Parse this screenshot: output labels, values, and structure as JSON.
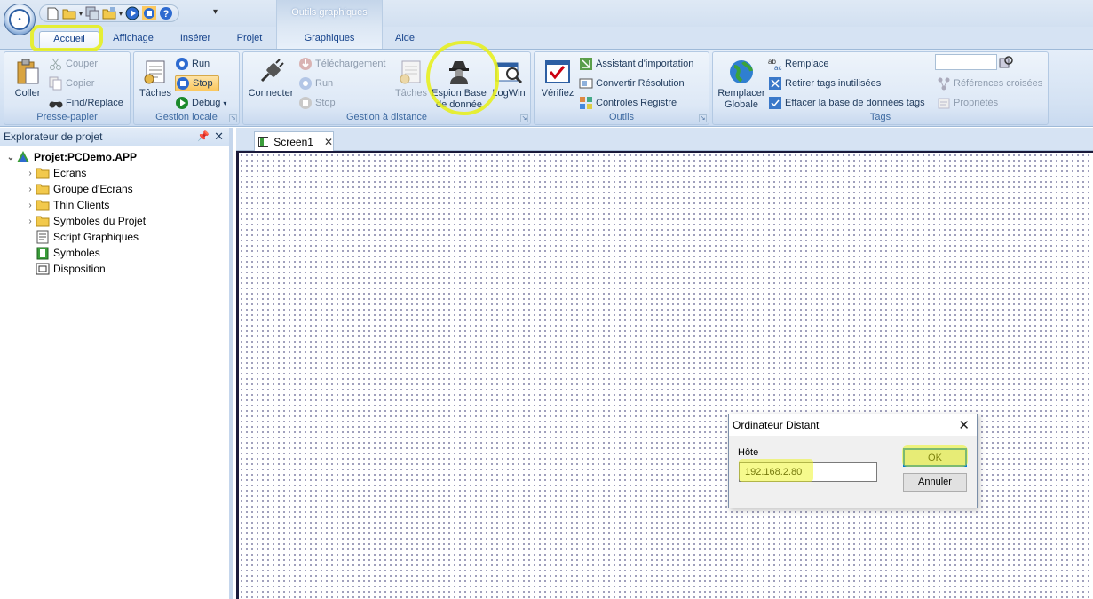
{
  "title_bar": {
    "contextual_header": "Outils graphiques"
  },
  "tabs": [
    {
      "label": "Accueil",
      "active": true
    },
    {
      "label": "Affichage"
    },
    {
      "label": "Insérer"
    },
    {
      "label": "Projet"
    },
    {
      "label": "Graphiques",
      "contextual": true
    },
    {
      "label": "Aide"
    }
  ],
  "ribbon": {
    "presse_papier": {
      "label": "Presse-papier",
      "coller": "Coller",
      "couper": "Couper",
      "copier": "Copier",
      "find_replace": "Find/Replace"
    },
    "gestion_locale": {
      "label": "Gestion locale",
      "taches": "Tâches",
      "run": "Run",
      "stop": "Stop",
      "debug": "Debug"
    },
    "gestion_distance": {
      "label": "Gestion à distance",
      "connecter": "Connecter",
      "telechargement": "Téléchargement",
      "run": "Run",
      "stop": "Stop",
      "taches": "Tâches",
      "espion_line1": "Espion Base",
      "espion_line2": "de donnée",
      "logwin": "LogWin"
    },
    "outils": {
      "label": "Outils",
      "verifiez": "Vérifiez",
      "assistant": "Assistant d'importation",
      "convertir": "Convertir Résolution",
      "controles": "Controles Registre"
    },
    "tags": {
      "label": "Tags",
      "remplacer_line1": "Remplacer",
      "remplacer_line2": "Globale",
      "remplace": "Remplace",
      "retirer": "Retirer tags inutilisées",
      "effacer": "Effacer la base de données tags",
      "references": "Références croisées",
      "proprietes": "Propriétés"
    }
  },
  "explorer": {
    "title": "Explorateur de projet",
    "root": "Projet:PCDemo.APP",
    "folders": [
      "Ecrans",
      "Groupe d'Ecrans",
      "Thin Clients",
      "Symboles du Projet"
    ],
    "leaves": [
      "Script Graphiques",
      "Symboles",
      "Disposition"
    ]
  },
  "document": {
    "tab": "Screen1"
  },
  "dialog": {
    "title": "Ordinateur Distant",
    "host_label": "Hôte",
    "host_value": "192.168.2.80",
    "ok": "OK",
    "cancel": "Annuler"
  },
  "colors": {
    "highlight": "#ecf514",
    "ribbon": "#d4e2f3",
    "accent": "#15428b"
  }
}
